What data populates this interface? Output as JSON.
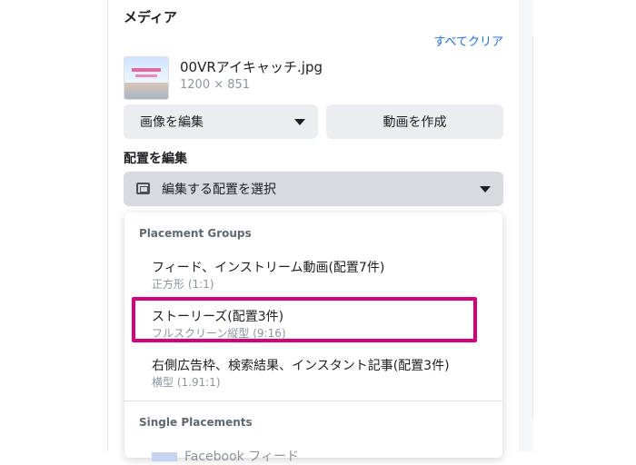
{
  "media": {
    "title": "メディア",
    "clear_all": "すべてクリア",
    "file_name": "00VRアイキャッチ.jpg",
    "file_size": "1200 × 851"
  },
  "buttons": {
    "edit_image": "画像を編集",
    "create_video": "動画を作成"
  },
  "placement": {
    "title": "配置を編集",
    "select_label": "編集する配置を選択"
  },
  "dropdown": {
    "group_title": "Placement Groups",
    "options": [
      {
        "label": "フィード、インストリーム動画(配置7件)",
        "sub": "正方形 (1:1)"
      },
      {
        "label": "ストーリーズ(配置3件)",
        "sub": "フルスクリーン縦型 (9:16)"
      },
      {
        "label": "右側広告枠、検索結果、インスタント記事(配置3件)",
        "sub": "横型 (1.91:1)"
      }
    ],
    "single_title": "Single Placements",
    "single_first": "Facebook フィード"
  },
  "colors": {
    "link": "#216fdb",
    "highlight": "#d4007a"
  }
}
